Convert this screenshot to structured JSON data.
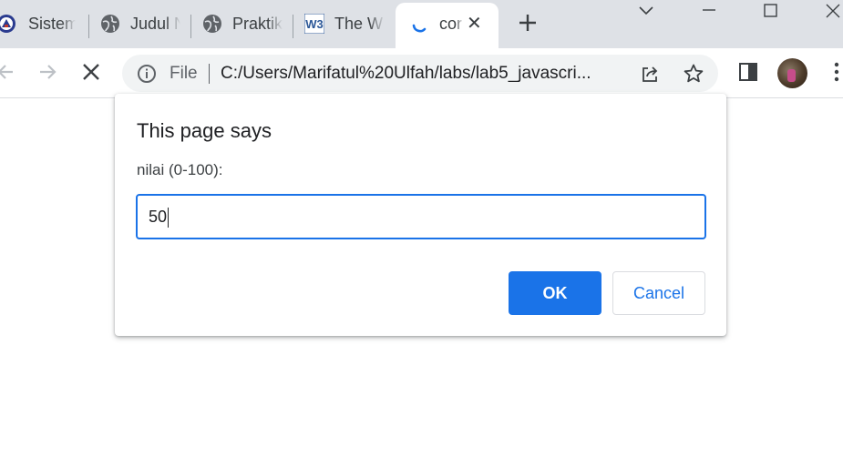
{
  "browser": {
    "tabs": [
      {
        "title": "Sistem",
        "icon": "university-logo-icon"
      },
      {
        "title": "Judul N",
        "icon": "globe-icon"
      },
      {
        "title": "Praktik",
        "icon": "globe-icon"
      },
      {
        "title": "The W",
        "icon": "w3schools-icon"
      },
      {
        "title": "cor",
        "icon": "loading-spinner-icon",
        "active": true
      }
    ],
    "new_tab_icon": "plus-icon",
    "window_controls": [
      "chevron-down-icon",
      "minimize-icon",
      "maximize-icon",
      "close-icon"
    ]
  },
  "toolbar": {
    "nav_icons": [
      "back-arrow-icon",
      "forward-arrow-icon",
      "stop-loading-icon"
    ],
    "site_info_label": "File",
    "url": "C:/Users/Marifatul%20Ulfah/labs/lab5_javascri...",
    "omnibox_icons": [
      "info-icon",
      "share-icon",
      "star-icon"
    ],
    "side_icons": [
      "side-panel-icon",
      "avatar",
      "more-vert-icon"
    ]
  },
  "dialog": {
    "title": "This page says",
    "message": "nilai (0-100):",
    "input_value": "50",
    "ok_label": "OK",
    "cancel_label": "Cancel"
  },
  "colors": {
    "accent": "#1a73e8",
    "tabstrip_bg": "#dee1e6",
    "omnibox_bg": "#f1f3f4"
  }
}
